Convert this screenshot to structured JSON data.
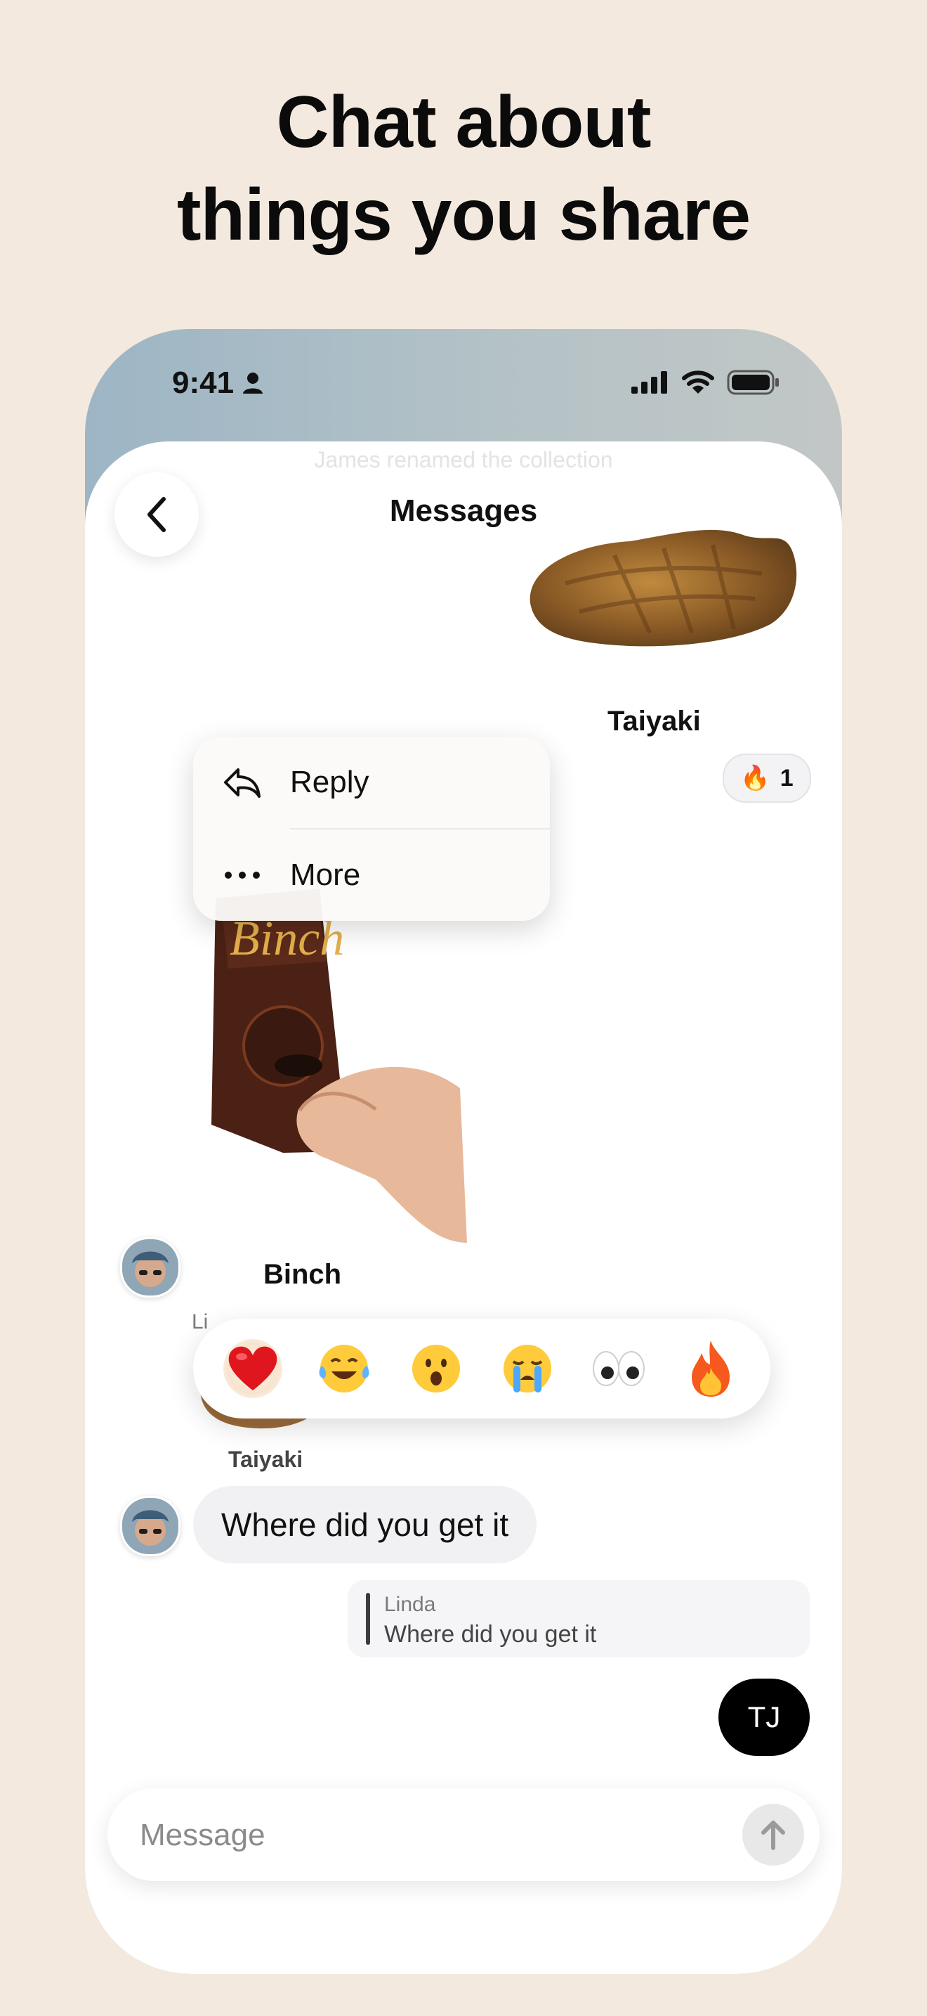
{
  "headline": {
    "line1": "Chat about",
    "line2": "things you share"
  },
  "status_bar": {
    "time": "9:41",
    "icons": [
      "person-icon",
      "cellular-signal-icon",
      "wifi-icon",
      "battery-icon"
    ]
  },
  "chat": {
    "faded_system_note": "James renamed the collection",
    "title": "Messages",
    "back_icon": "chevron-left-icon",
    "items": [
      {
        "type": "sticker",
        "caption": "Taiyaki",
        "reaction": {
          "emoji": "🔥",
          "count": "1"
        }
      },
      {
        "type": "sticker",
        "caption": "Binch",
        "sender_fragment": "Li"
      },
      {
        "type": "sticker",
        "caption": "Taiyaki"
      },
      {
        "type": "text",
        "direction": "incoming",
        "text": "Where did you get it"
      },
      {
        "type": "reply_quote",
        "name": "Linda",
        "text": "Where did you get it"
      },
      {
        "type": "text",
        "direction": "outgoing",
        "text": "TJ"
      }
    ]
  },
  "context_menu": {
    "items": [
      {
        "label": "Reply",
        "icon": "reply-arrow-icon"
      },
      {
        "label": "More",
        "icon": "ellipsis-icon"
      }
    ]
  },
  "emoji_reactions": [
    "❤️",
    "😂",
    "😮",
    "😭",
    "👀",
    "🔥"
  ],
  "composer": {
    "placeholder": "Message",
    "send_icon": "arrow-up-icon"
  },
  "colors": {
    "page_background": "#f4e9de",
    "outgoing_bubble": "#000000",
    "incoming_bubble": "#f1f1f3"
  }
}
